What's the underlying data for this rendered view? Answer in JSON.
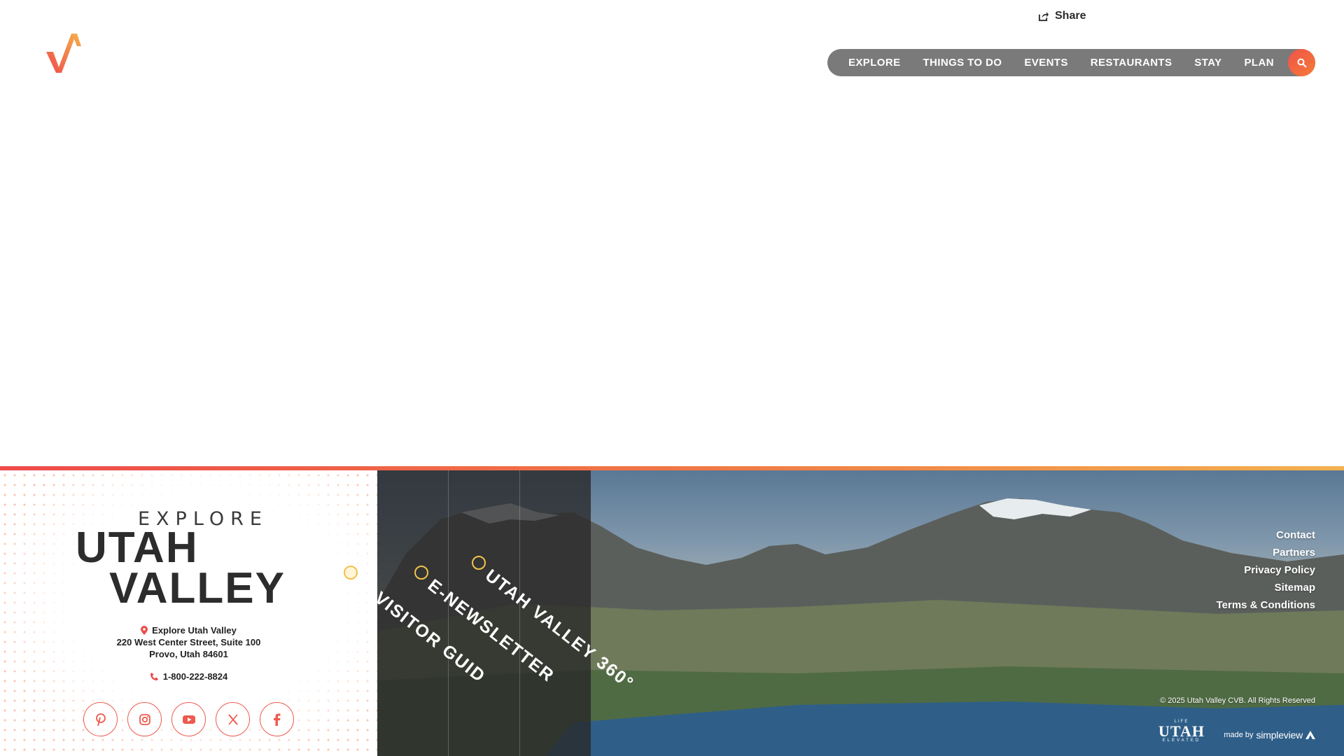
{
  "header": {
    "share_label": "Share",
    "nav": [
      {
        "label": "EXPLORE"
      },
      {
        "label": "THINGS TO DO"
      },
      {
        "label": "EVENTS"
      },
      {
        "label": "RESTAURANTS"
      },
      {
        "label": "STAY"
      },
      {
        "label": "PLAN"
      }
    ],
    "search_icon": "search-icon"
  },
  "footer": {
    "logo": {
      "top": "EXPLORE",
      "line1": "UTAH",
      "line2": "VALLEY"
    },
    "address": {
      "name": "Explore Utah Valley",
      "street": "220 West Center Street, Suite 100",
      "city": "Provo, Utah 84601"
    },
    "phone": "1-800-222-8824",
    "socials": [
      {
        "icon": "pinterest-icon"
      },
      {
        "icon": "instagram-icon"
      },
      {
        "icon": "youtube-icon"
      },
      {
        "icon": "x-icon"
      },
      {
        "icon": "facebook-icon"
      }
    ],
    "promos": [
      {
        "label": "VISITOR GUID"
      },
      {
        "label": "E-NEWSLETTER"
      },
      {
        "label": "UTAH VALLEY 360°"
      }
    ],
    "links": [
      {
        "label": "Contact"
      },
      {
        "label": "Partners"
      },
      {
        "label": "Privacy Policy"
      },
      {
        "label": "Sitemap"
      },
      {
        "label": "Terms & Conditions"
      }
    ],
    "copyright": "© 2025 Utah Valley CVB. All Rights Reserved",
    "life_elevated": {
      "top": "LIFE",
      "main": "UTAH",
      "bottom": "ELEVATED"
    },
    "made_by": {
      "prefix": "made by",
      "brand": "simpleview"
    }
  },
  "colors": {
    "accent": "#f0534a",
    "accent_orange": "#f47a36",
    "nav_bg": "#7a7a7a",
    "badge": "#f2c24a"
  }
}
